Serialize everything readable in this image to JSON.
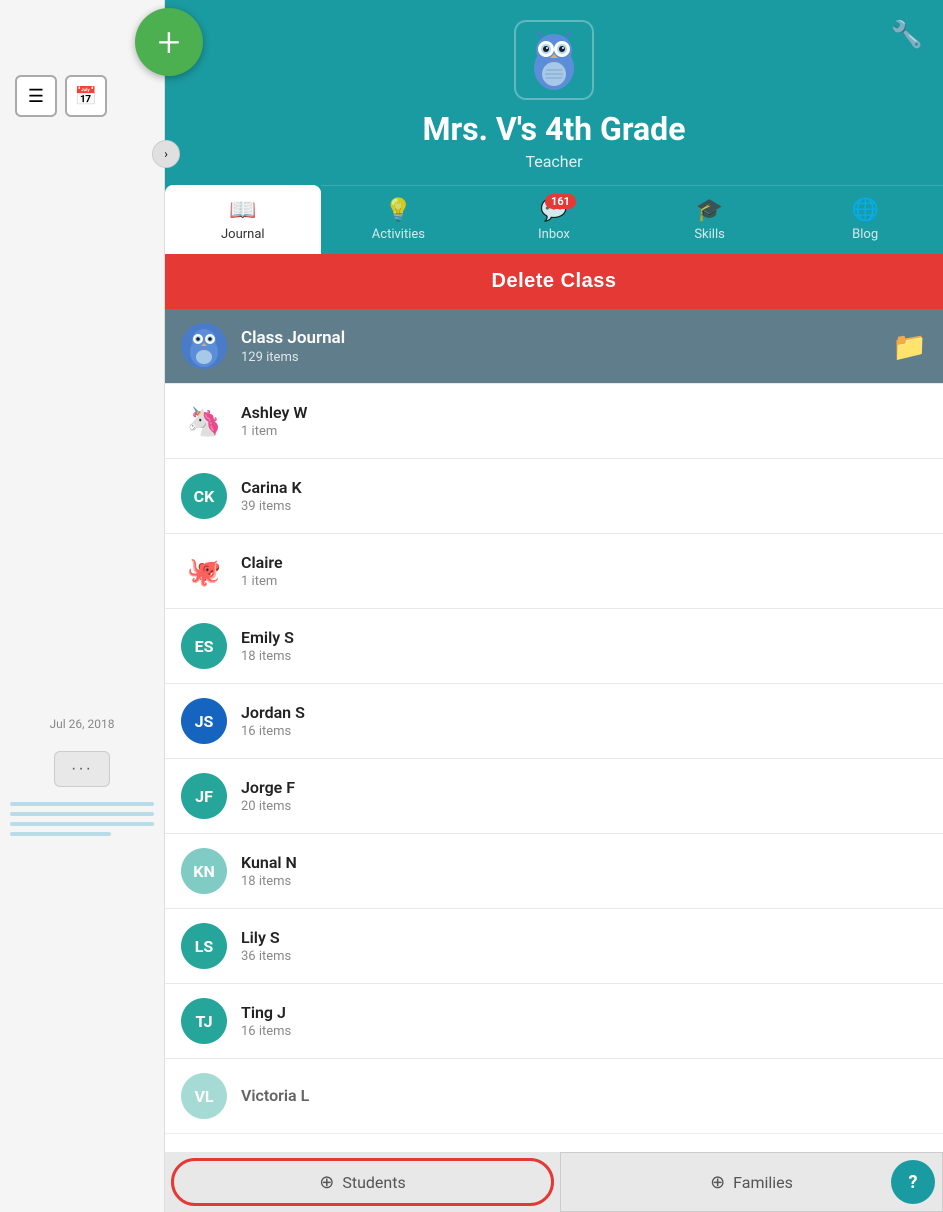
{
  "app": {
    "title": "Mrs. V's 4th Grade",
    "subtitle": "Teacher"
  },
  "header": {
    "wrench_icon": "🔧"
  },
  "tabs": [
    {
      "id": "journal",
      "label": "Journal",
      "icon": "📖",
      "active": true,
      "badge": null
    },
    {
      "id": "activities",
      "label": "Activities",
      "icon": "💡",
      "active": false,
      "badge": null
    },
    {
      "id": "inbox",
      "label": "Inbox",
      "icon": "💬",
      "active": false,
      "badge": "161"
    },
    {
      "id": "skills",
      "label": "Skills",
      "icon": "🎓",
      "active": false,
      "badge": null
    },
    {
      "id": "blog",
      "label": "Blog",
      "icon": "🌐",
      "active": false,
      "badge": null
    }
  ],
  "delete_class_label": "Delete Class",
  "journal_items": [
    {
      "id": "class-journal",
      "name": "Class Journal",
      "count": "129 items",
      "avatar_type": "owl",
      "is_class": true
    },
    {
      "id": "ashley",
      "name": "Ashley W",
      "count": "1 item",
      "avatar_type": "emoji",
      "emoji": "🦄",
      "initials": null,
      "color": null
    },
    {
      "id": "carina",
      "name": "Carina K",
      "count": "39 items",
      "avatar_type": "initials",
      "initials": "CK",
      "color": "#26a69a"
    },
    {
      "id": "claire",
      "name": "Claire",
      "count": "1 item",
      "avatar_type": "emoji",
      "emoji": "🐙",
      "initials": null,
      "color": null
    },
    {
      "id": "emily",
      "name": "Emily S",
      "count": "18 items",
      "avatar_type": "initials",
      "initials": "ES",
      "color": "#26a69a"
    },
    {
      "id": "jordan",
      "name": "Jordan S",
      "count": "16 items",
      "avatar_type": "initials",
      "initials": "JS",
      "color": "#1565c0"
    },
    {
      "id": "jorge",
      "name": "Jorge F",
      "count": "20 items",
      "avatar_type": "initials",
      "initials": "JF",
      "color": "#26a69a"
    },
    {
      "id": "kunal",
      "name": "Kunal N",
      "count": "18 items",
      "avatar_type": "initials",
      "initials": "KN",
      "color": "#80cbc4"
    },
    {
      "id": "lily",
      "name": "Lily S",
      "count": "36 items",
      "avatar_type": "initials",
      "initials": "LS",
      "color": "#26a69a"
    },
    {
      "id": "ting",
      "name": "Ting J",
      "count": "16 items",
      "avatar_type": "initials",
      "initials": "TJ",
      "color": "#26a69a"
    },
    {
      "id": "victoria",
      "name": "Victoria L",
      "count": "",
      "avatar_type": "initials",
      "initials": "VL",
      "color": "#80cbc4"
    }
  ],
  "bottom_tabs": [
    {
      "id": "students",
      "label": "Students",
      "icon": "➕",
      "highlighted": true
    },
    {
      "id": "families",
      "label": "Families",
      "icon": "➕",
      "highlighted": false
    }
  ],
  "sidebar": {
    "date": "Jul 26, 2018",
    "more_label": "···"
  }
}
